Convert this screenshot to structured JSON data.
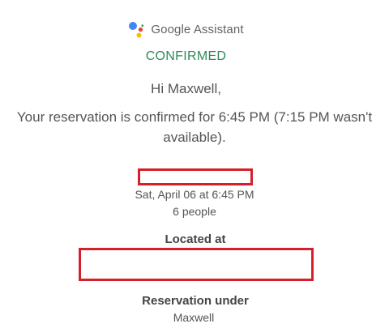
{
  "brand": {
    "logo_icon": "google-assistant-icon",
    "name_google": "Google",
    "name_product": "Assistant"
  },
  "status": "CONFIRMED",
  "greeting": "Hi Maxwell,",
  "message": "Your reservation is confirmed for 6:45 PM (7:15 PM wasn't available).",
  "reservation": {
    "datetime": "Sat, April 06 at 6:45 PM",
    "party_size": "6 people",
    "located_label": "Located at",
    "under_label": "Reservation under",
    "under_name": "Maxwell"
  },
  "colors": {
    "status": "#2e8b57",
    "redaction": "#d5202b"
  }
}
